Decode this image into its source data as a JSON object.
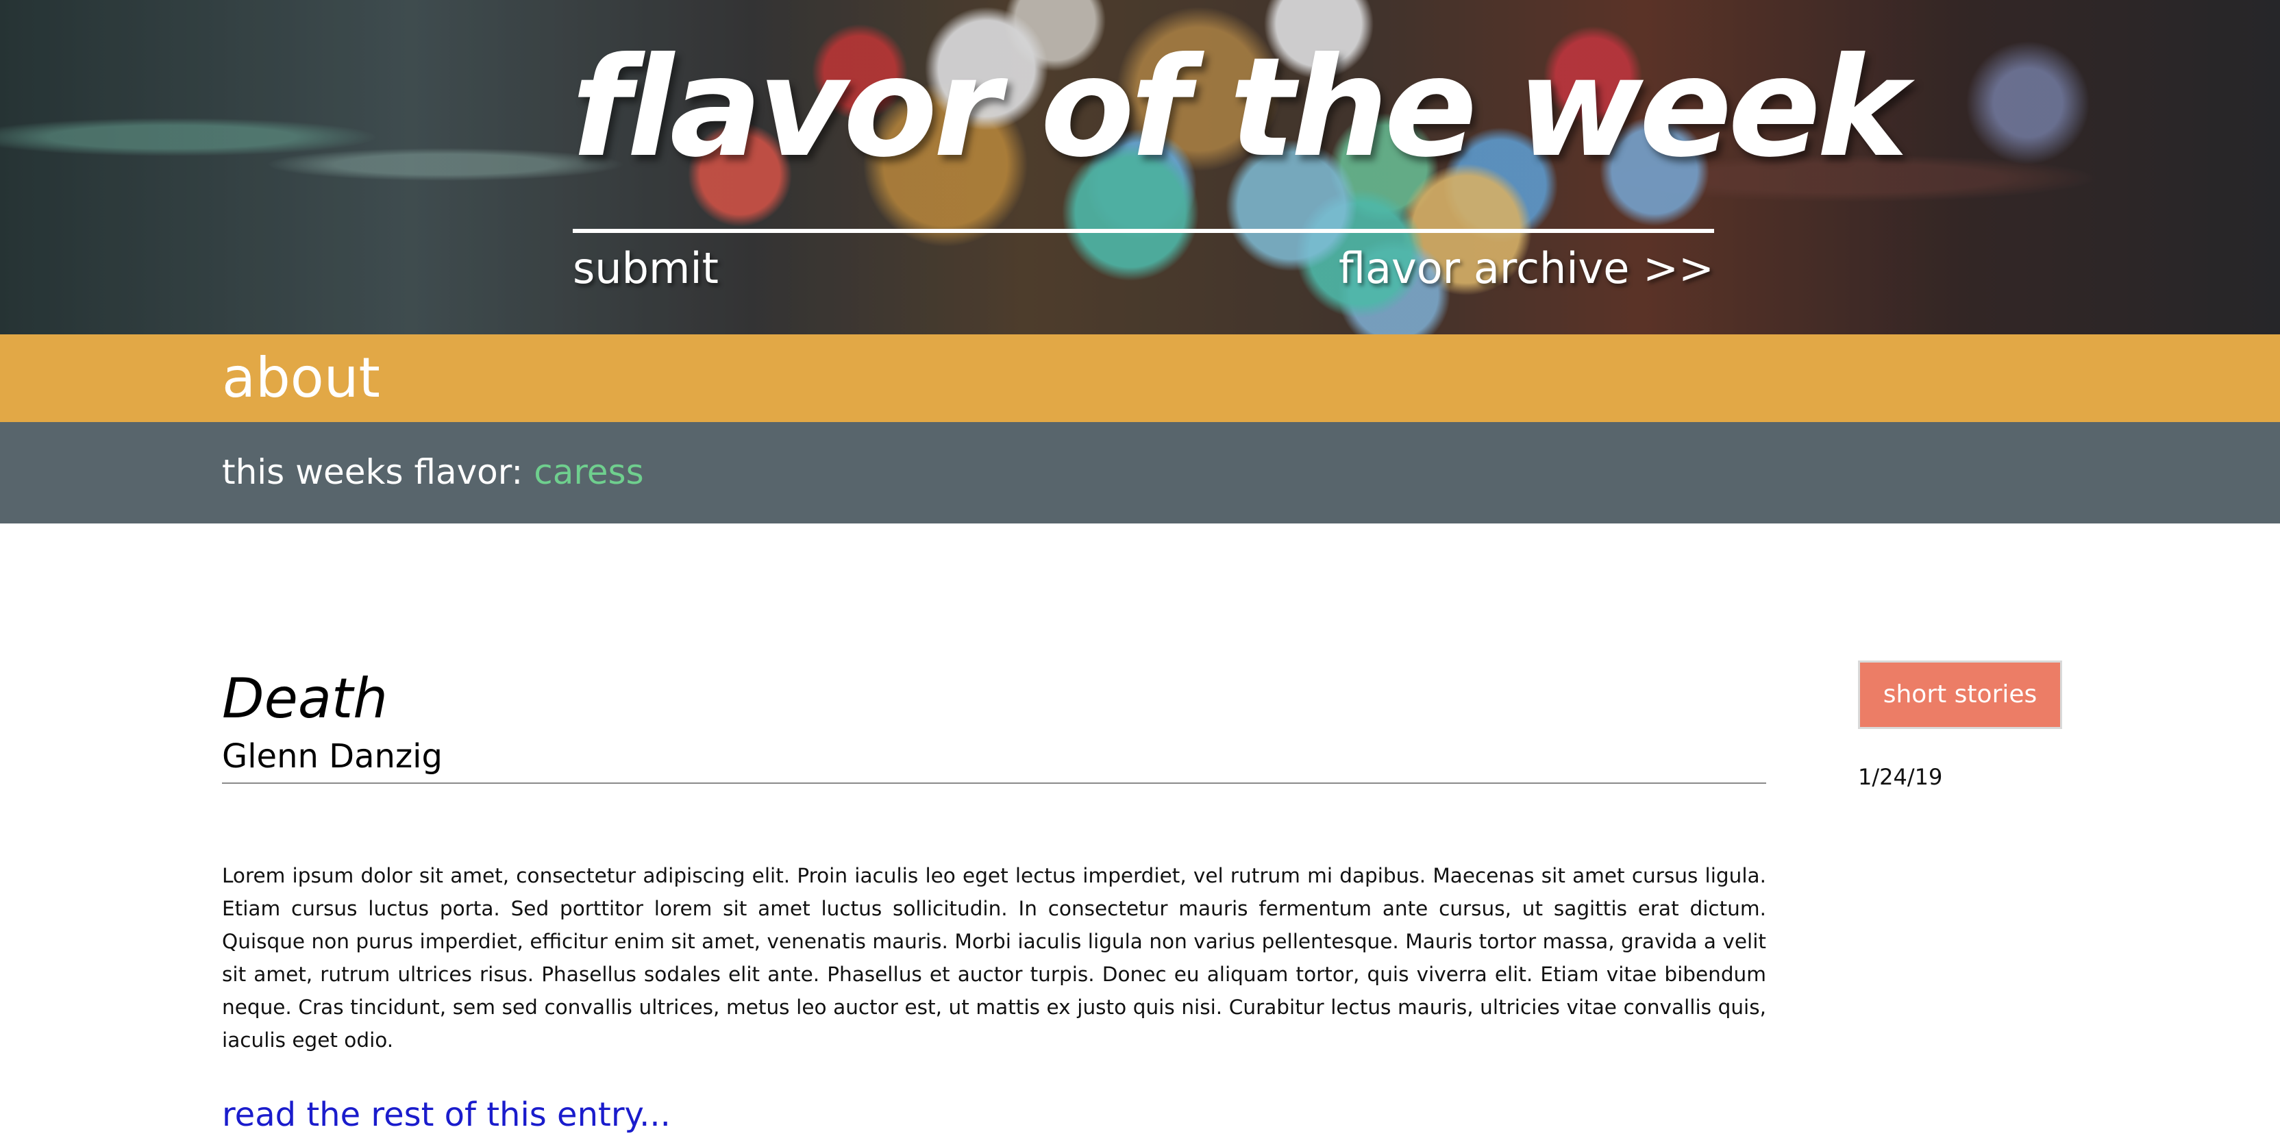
{
  "header": {
    "title": "flavor of the week",
    "nav_submit": "submit",
    "nav_archive": "flavor archive >>"
  },
  "about_bar": {
    "label": "about"
  },
  "flavor_bar": {
    "prefix": "this weeks flavor:",
    "value": "caress"
  },
  "post": {
    "title": "Death",
    "author": "Glenn Danzig",
    "body": "Lorem ipsum dolor sit amet, consectetur adipiscing elit. Proin iaculis leo eget lectus imperdiet, vel rutrum mi dapibus. Maecenas sit amet cursus ligula. Etiam cursus luctus porta. Sed porttitor lorem sit amet luctus sollicitudin. In consectetur mauris fermentum ante cursus, ut sagittis erat dictum. Quisque non purus imperdiet, efficitur enim sit amet, venenatis mauris. Morbi iaculis ligula non varius pellentesque. Mauris tortor massa, gravida a velit sit amet, rutrum ultrices risus. Phasellus sodales elit ante. Phasellus et auctor turpis. Donec eu aliquam tortor, quis viverra elit. Etiam vitae bibendum neque. Cras tincidunt, sem sed convallis ultrices, metus leo auctor est, ut mattis ex justo quis nisi. Curabitur lectus mauris, ultricies vitae convallis quis, iaculis eget odio.",
    "read_more": "read the rest of this entry...",
    "category": "short stories",
    "date": "1/24/19"
  },
  "colors": {
    "about_bar": "#e2a846",
    "flavor_bar": "#58656c",
    "flavor_value": "#6fcf8e",
    "category_button": "#ec7d66",
    "read_more_link": "#1a1ccc"
  }
}
